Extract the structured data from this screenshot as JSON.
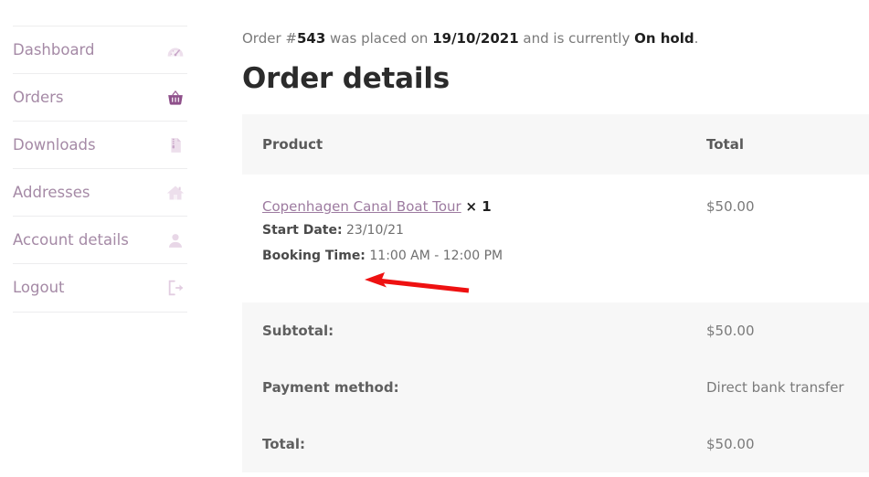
{
  "sidebar": {
    "items": [
      {
        "label": "Dashboard",
        "icon": "dashboard-gauge-icon",
        "name": "sidebar-item-dashboard"
      },
      {
        "label": "Orders",
        "icon": "basket-icon",
        "name": "sidebar-item-orders"
      },
      {
        "label": "Downloads",
        "icon": "file-zip-icon",
        "name": "sidebar-item-downloads"
      },
      {
        "label": "Addresses",
        "icon": "home-icon",
        "name": "sidebar-item-addresses"
      },
      {
        "label": "Account details",
        "icon": "user-icon",
        "name": "sidebar-item-account-details"
      },
      {
        "label": "Logout",
        "icon": "sign-out-icon",
        "name": "sidebar-item-logout"
      }
    ]
  },
  "order_status": {
    "prefix": "Order #",
    "order_number": "543",
    "middle": " was placed on ",
    "date": "19/10/2021",
    "middle2": " and is currently ",
    "status": "On hold",
    "suffix": "."
  },
  "main": {
    "heading": "Order details"
  },
  "table": {
    "headers": {
      "product": "Product",
      "total": "Total"
    },
    "rows": [
      {
        "product_name": "Copenhagen Canal Boat Tour",
        "quantity": "× 1",
        "meta": [
          {
            "label": "Start Date:",
            "value": "23/10/21"
          },
          {
            "label": "Booking Time:",
            "value": "11:00 AM - 12:00 PM"
          }
        ],
        "total": "$50.00"
      }
    ],
    "footer": [
      {
        "label": "Subtotal:",
        "value": "$50.00"
      },
      {
        "label": "Payment method:",
        "value": "Direct bank transfer"
      },
      {
        "label": "Total:",
        "value": "$50.00"
      }
    ]
  },
  "annotation": {
    "arrow_color": "#ee1111"
  },
  "colors": {
    "sidebar_link": "#a58aa6",
    "product_link": "#9d7ba0",
    "row_alt_bg": "#f7f7f7"
  }
}
